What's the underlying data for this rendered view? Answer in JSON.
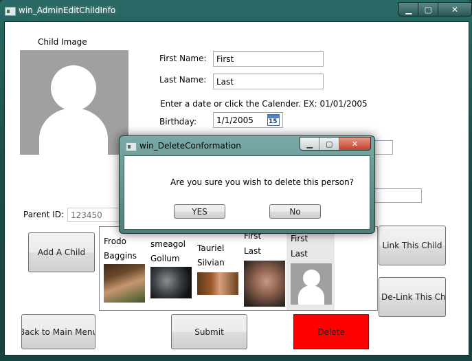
{
  "window": {
    "title": "win_AdminEditChildInfo"
  },
  "caption_buttons": {
    "minimize": "▁",
    "maximize": "▢",
    "close": "✕"
  },
  "child_image": {
    "label": "Child Image"
  },
  "form": {
    "first_name_label": "First Name:",
    "first_name_value": "First",
    "last_name_label": "Last Name:",
    "last_name_value": "Last",
    "date_hint": "Enter a date or click the Calender. EX: 01/01/2005",
    "birthday_label": "Birthday:",
    "birthday_value": "1/1/2005",
    "calendar_day": "15",
    "parent_id_label": "Parent ID:",
    "parent_id_placeholder": "123450"
  },
  "buttons": {
    "add_child": "Add A Child",
    "link_child": "Link This Child",
    "delink_child": "De-Link This Child",
    "back_main": "Back to Main Menu",
    "submit": "Submit",
    "delete": "Delete"
  },
  "children": [
    {
      "first": "Frodo",
      "last": "Baggins",
      "photo": "frodo-photo"
    },
    {
      "first": "smeagol",
      "last": "Gollum",
      "photo": "gollum-photo"
    },
    {
      "first": "Tauriel",
      "last": "Silvian",
      "photo": "tauriel-photo"
    },
    {
      "first": "First",
      "last": "Last",
      "photo": "old-man-photo"
    },
    {
      "first": "First",
      "last": "Last",
      "photo": "default-avatar",
      "selected": true
    }
  ],
  "dialog": {
    "title": "win_DeleteConformation",
    "message": "Are you sure you wish to delete this person?",
    "yes": "YES",
    "no": "No"
  },
  "colors": {
    "delete_button": "#ff0000",
    "avatar_bg": "#a0a0a0"
  }
}
